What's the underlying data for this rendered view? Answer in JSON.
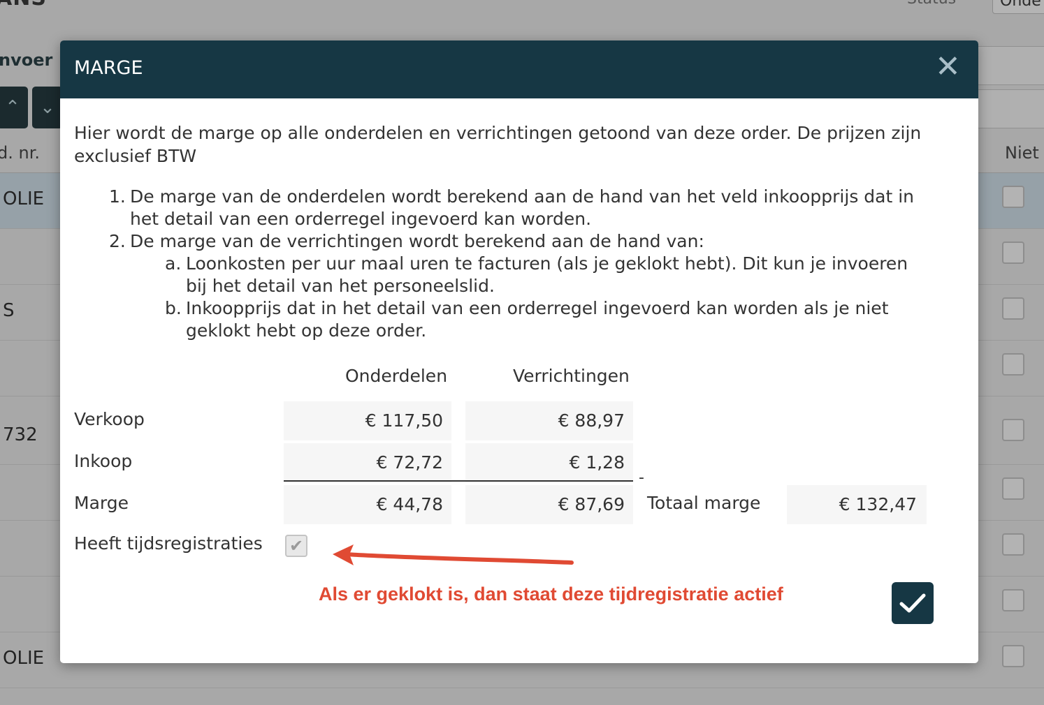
{
  "background": {
    "title": "ANS",
    "status_label": "Status",
    "status_value": "Onde",
    "invoer_label": "nvoer",
    "col_nr": "d. nr.",
    "col_niet": "Niet",
    "rows": [
      "OLIE",
      "",
      "S",
      "",
      "732",
      "",
      "",
      "",
      "OLIE"
    ]
  },
  "modal": {
    "title": "MARGE",
    "close_icon": "close-icon",
    "intro": "Hier wordt de marge op alle onderdelen en verrichtingen getoond van deze order. De prijzen zijn exclusief BTW",
    "list": [
      {
        "num": "1.",
        "text": "De marge van de onderdelen wordt berekend aan de hand van het veld inkoopprijs dat in het detail van een orderregel ingevoerd kan worden."
      },
      {
        "num": "2.",
        "text": "De marge van de verrichtingen wordt berekend aan de hand van:"
      }
    ],
    "sublist": [
      {
        "num": "a.",
        "text": "Loonkosten per uur maal uren te facturen (als je geklokt hebt). Dit kun je invoeren bij het detail van het personeelslid."
      },
      {
        "num": "b.",
        "text": "Inkoopprijs dat in het detail van een orderregel ingevoerd kan worden als je niet geklokt hebt op deze order."
      }
    ],
    "table": {
      "col_onderdelen": "Onderdelen",
      "col_verrichtingen": "Verrichtingen",
      "verkoop_label": "Verkoop",
      "verkoop_onderdelen": "€ 117,50",
      "verkoop_verrichtingen": "€ 88,97",
      "inkoop_label": "Inkoop",
      "inkoop_onderdelen": "€ 72,72",
      "inkoop_verrichtingen": "€ 1,28",
      "minus_sign": "-",
      "marge_label": "Marge",
      "marge_onderdelen": "€ 44,78",
      "marge_verrichtingen": "€ 87,69",
      "totaal_label": "Totaal marge",
      "totaal_value": "€ 132,47"
    },
    "tijd_label": "Heeft tijdsregistraties",
    "tijd_checked": true,
    "annotation": "Als er geklokt is, dan staat deze tijdregistratie actief",
    "annotation_color": "#e04a33",
    "header_color": "#163744"
  }
}
